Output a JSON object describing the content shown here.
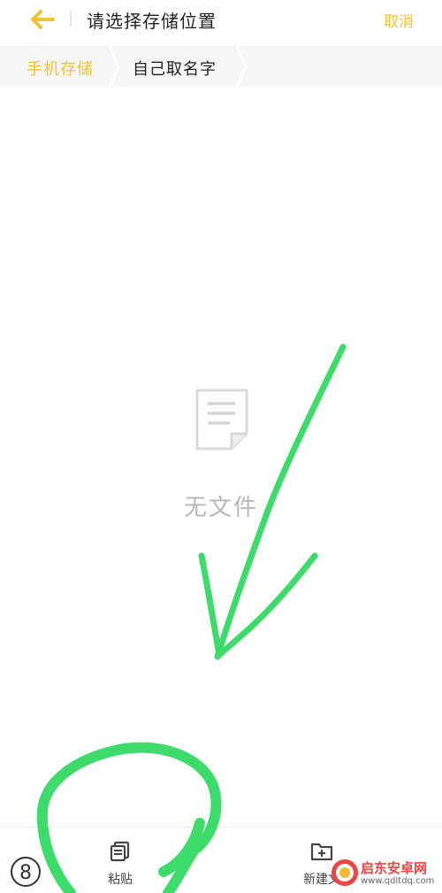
{
  "header": {
    "title": "请选择存储位置",
    "cancel_label": "取消"
  },
  "breadcrumb": {
    "items": [
      {
        "label": "手机存储"
      },
      {
        "label": "自己取名字"
      }
    ]
  },
  "empty_state": {
    "text": "无文件"
  },
  "bottom_bar": {
    "paste_label": "粘贴",
    "new_label": "新建文"
  },
  "watermark": {
    "name": "启东安卓网",
    "url": "www.qdltdq.com"
  },
  "page_indicator": "8",
  "colors": {
    "accent": "#f1c232",
    "annotation": "#3ddc6a",
    "empty_text": "#b7b7b7"
  },
  "icons": {
    "back": "arrow-left-icon",
    "empty": "document-icon",
    "paste": "paste-icon",
    "new_folder": "folder-add-icon"
  }
}
